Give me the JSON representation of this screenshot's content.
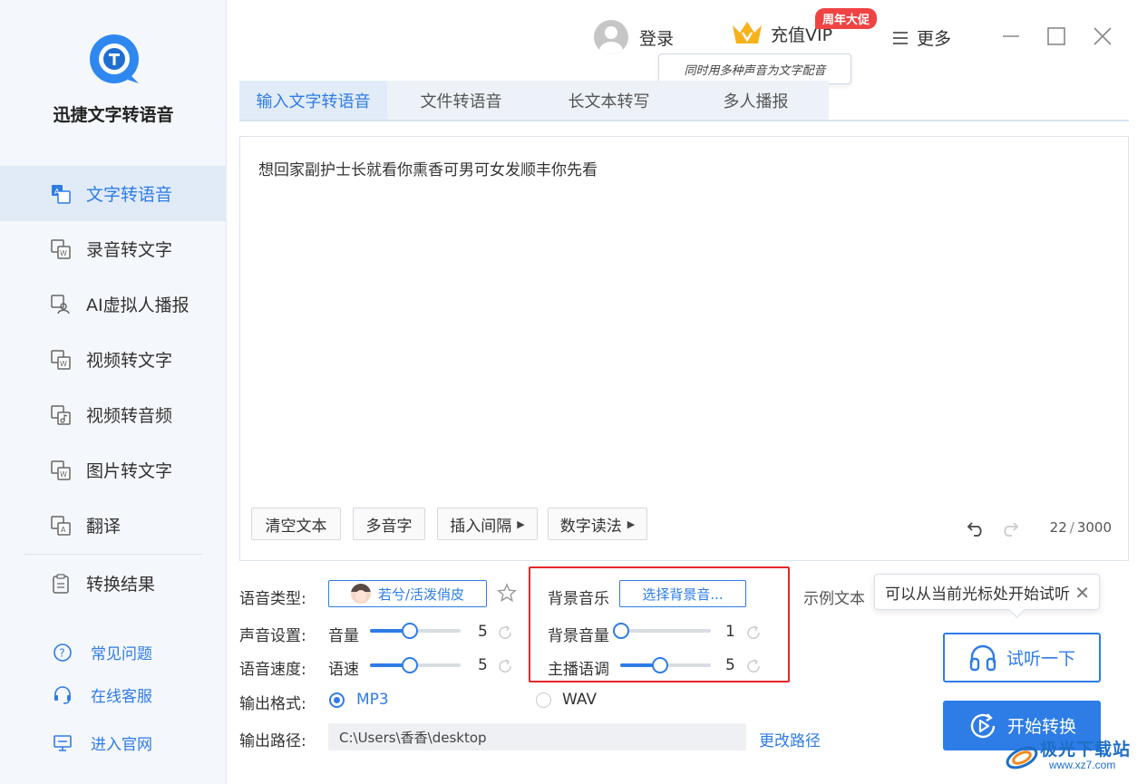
{
  "app": {
    "title": "迅捷文字转语音"
  },
  "sidebar": {
    "items": [
      {
        "label": "文字转语音",
        "icon": "text-to-speech-icon",
        "active": true
      },
      {
        "label": "录音转文字",
        "icon": "audio-to-text-icon"
      },
      {
        "label": "AI虚拟人播报",
        "icon": "ai-avatar-icon"
      },
      {
        "label": "视频转文字",
        "icon": "video-to-text-icon"
      },
      {
        "label": "视频转音频",
        "icon": "video-to-audio-icon"
      },
      {
        "label": "图片转文字",
        "icon": "image-to-text-icon"
      },
      {
        "label": "翻译",
        "icon": "translate-icon"
      }
    ],
    "results": {
      "label": "转换结果",
      "icon": "clipboard-icon"
    },
    "help": [
      {
        "label": "常见问题",
        "icon": "question-icon"
      },
      {
        "label": "在线客服",
        "icon": "headset-icon"
      },
      {
        "label": "进入官网",
        "icon": "monitor-icon"
      }
    ]
  },
  "topbar": {
    "login": "登录",
    "vip": "充值VIP",
    "promo_badge": "周年大促",
    "more": "更多",
    "tooltip": "同时用多种声音为文字配音"
  },
  "tabs": [
    "输入文字转语音",
    "文件转语音",
    "长文本转写",
    "多人播报"
  ],
  "editor": {
    "text": "想回家副护士长就看你熏香可男可女发顺丰你先看",
    "buttons": [
      "清空文本",
      "多音字",
      "插入间隔",
      "数字读法"
    ],
    "count": "22",
    "max": "3000"
  },
  "settings": {
    "voice_type_label": "语音类型:",
    "voice_name": "若兮/活泼俏皮",
    "sound_label": "声音设置:",
    "volume_label": "音量",
    "volume_value": "5",
    "speed_row_label": "语音速度:",
    "speed_label": "语速",
    "speed_value": "5",
    "bgm_label": "背景音乐",
    "bgm_button": "选择背景音...",
    "bg_volume_label": "背景音量",
    "bg_volume_value": "1",
    "pitch_label": "主播语调",
    "pitch_value": "5",
    "sample_text": "示例文本",
    "tip": "可以从当前光标处开始试听",
    "format_label": "输出格式:",
    "format_options": [
      "MP3",
      "WAV"
    ],
    "selected_format": "MP3",
    "path_label": "输出路径:",
    "path_value": "C:\\Users\\香香\\desktop",
    "change_path": "更改路径"
  },
  "actions": {
    "listen": "试听一下",
    "start": "开始转换"
  },
  "watermark": {
    "title": "极光下载站",
    "url": "www.xz7.com"
  },
  "colors": {
    "accent": "#2e7ce6",
    "highlight_border": "#e8262a",
    "promo": "#f04343",
    "vip_gold": "#f5b21b"
  }
}
